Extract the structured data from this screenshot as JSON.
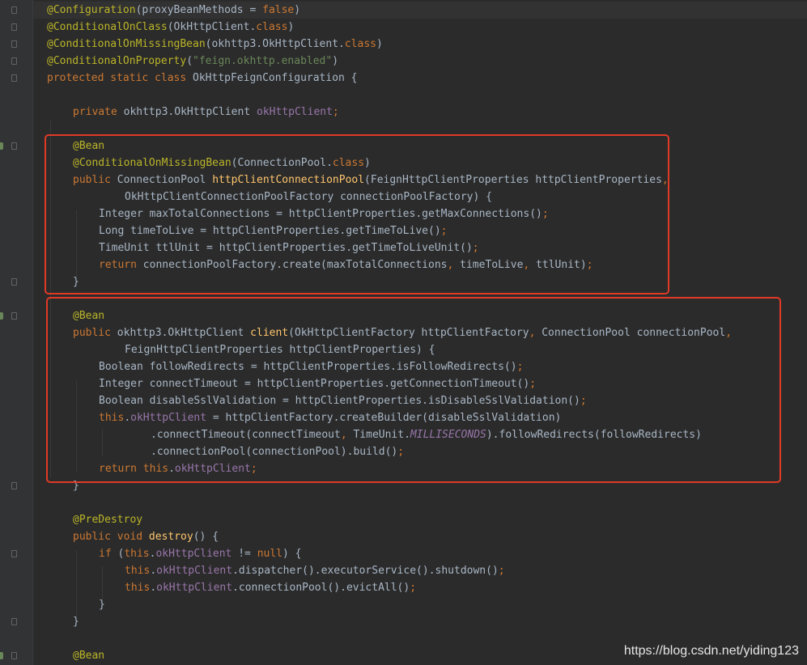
{
  "editor": {
    "lines": [
      {
        "indent": 0,
        "tokens": [
          [
            "annotation",
            "@Configuration"
          ],
          [
            "plain",
            "(proxyBeanMethods = "
          ],
          [
            "keyword",
            "false"
          ],
          [
            "plain",
            ")"
          ]
        ]
      },
      {
        "indent": 0,
        "tokens": [
          [
            "annotation",
            "@ConditionalOnClass"
          ],
          [
            "plain",
            "(OkHttpClient."
          ],
          [
            "keyword",
            "class"
          ],
          [
            "plain",
            ")"
          ]
        ]
      },
      {
        "indent": 0,
        "tokens": [
          [
            "annotation",
            "@ConditionalOnMissingBean"
          ],
          [
            "plain",
            "(okhttp3.OkHttpClient."
          ],
          [
            "keyword",
            "class"
          ],
          [
            "plain",
            ")"
          ]
        ]
      },
      {
        "indent": 0,
        "tokens": [
          [
            "annotation",
            "@ConditionalOnProperty"
          ],
          [
            "plain",
            "("
          ],
          [
            "string",
            "\"feign.okhttp.enabled\""
          ],
          [
            "plain",
            ")"
          ]
        ]
      },
      {
        "indent": 0,
        "tokens": [
          [
            "keyword",
            "protected static class "
          ],
          [
            "plain",
            "OkHttpFeignConfiguration {"
          ]
        ]
      },
      {
        "indent": 0,
        "tokens": []
      },
      {
        "indent": 1,
        "tokens": [
          [
            "keyword",
            "private "
          ],
          [
            "plain",
            "okhttp3.OkHttpClient "
          ],
          [
            "field",
            "okHttpClient"
          ],
          [
            "keyword",
            ";"
          ]
        ]
      },
      {
        "indent": 0,
        "tokens": []
      },
      {
        "indent": 1,
        "tokens": [
          [
            "annotation",
            "@Bean"
          ]
        ]
      },
      {
        "indent": 1,
        "tokens": [
          [
            "annotation",
            "@ConditionalOnMissingBean"
          ],
          [
            "plain",
            "(ConnectionPool."
          ],
          [
            "keyword",
            "class"
          ],
          [
            "plain",
            ")"
          ]
        ]
      },
      {
        "indent": 1,
        "tokens": [
          [
            "keyword",
            "public "
          ],
          [
            "plain",
            "ConnectionPool "
          ],
          [
            "method",
            "httpClientConnectionPool"
          ],
          [
            "plain",
            "(FeignHttpClientProperties httpClientProperties"
          ],
          [
            "keyword",
            ","
          ]
        ]
      },
      {
        "indent": 3,
        "tokens": [
          [
            "plain",
            "OkHttpClientConnectionPoolFactory connectionPoolFactory) {"
          ]
        ]
      },
      {
        "indent": 2,
        "tokens": [
          [
            "plain",
            "Integer maxTotalConnections = httpClientProperties.getMaxConnections()"
          ],
          [
            "keyword",
            ";"
          ]
        ]
      },
      {
        "indent": 2,
        "tokens": [
          [
            "plain",
            "Long timeToLive = httpClientProperties.getTimeToLive()"
          ],
          [
            "keyword",
            ";"
          ]
        ]
      },
      {
        "indent": 2,
        "tokens": [
          [
            "plain",
            "TimeUnit ttlUnit = httpClientProperties.getTimeToLiveUnit()"
          ],
          [
            "keyword",
            ";"
          ]
        ]
      },
      {
        "indent": 2,
        "tokens": [
          [
            "keyword",
            "return "
          ],
          [
            "plain",
            "connectionPoolFactory.create(maxTotalConnections"
          ],
          [
            "keyword",
            ", "
          ],
          [
            "plain",
            "timeToLive"
          ],
          [
            "keyword",
            ", "
          ],
          [
            "plain",
            "ttlUnit)"
          ],
          [
            "keyword",
            ";"
          ]
        ]
      },
      {
        "indent": 1,
        "tokens": [
          [
            "plain",
            "}"
          ]
        ]
      },
      {
        "indent": 0,
        "tokens": []
      },
      {
        "indent": 1,
        "tokens": [
          [
            "annotation",
            "@Bean"
          ]
        ]
      },
      {
        "indent": 1,
        "tokens": [
          [
            "keyword",
            "public "
          ],
          [
            "plain",
            "okhttp3.OkHttpClient "
          ],
          [
            "method",
            "client"
          ],
          [
            "plain",
            "(OkHttpClientFactory httpClientFactory"
          ],
          [
            "keyword",
            ", "
          ],
          [
            "plain",
            "ConnectionPool connectionPool"
          ],
          [
            "keyword",
            ","
          ]
        ]
      },
      {
        "indent": 3,
        "tokens": [
          [
            "plain",
            "FeignHttpClientProperties httpClientProperties) {"
          ]
        ]
      },
      {
        "indent": 2,
        "tokens": [
          [
            "plain",
            "Boolean followRedirects = httpClientProperties.isFollowRedirects()"
          ],
          [
            "keyword",
            ";"
          ]
        ]
      },
      {
        "indent": 2,
        "tokens": [
          [
            "plain",
            "Integer connectTimeout = httpClientProperties.getConnectionTimeout()"
          ],
          [
            "keyword",
            ";"
          ]
        ]
      },
      {
        "indent": 2,
        "tokens": [
          [
            "plain",
            "Boolean disableSslValidation = httpClientProperties.isDisableSslValidation()"
          ],
          [
            "keyword",
            ";"
          ]
        ]
      },
      {
        "indent": 2,
        "tokens": [
          [
            "keyword",
            "this"
          ],
          [
            "plain",
            "."
          ],
          [
            "field",
            "okHttpClient"
          ],
          [
            "plain",
            " = httpClientFactory.createBuilder(disableSslValidation)"
          ]
        ]
      },
      {
        "indent": 4,
        "tokens": [
          [
            "plain",
            ".connectTimeout(connectTimeout"
          ],
          [
            "keyword",
            ", "
          ],
          [
            "plain",
            "TimeUnit."
          ],
          [
            "const",
            "MILLISECONDS"
          ],
          [
            "plain",
            ").followRedirects(followRedirects)"
          ]
        ]
      },
      {
        "indent": 4,
        "tokens": [
          [
            "plain",
            ".connectionPool(connectionPool).build()"
          ],
          [
            "keyword",
            ";"
          ]
        ]
      },
      {
        "indent": 2,
        "tokens": [
          [
            "keyword",
            "return this"
          ],
          [
            "plain",
            "."
          ],
          [
            "field",
            "okHttpClient"
          ],
          [
            "keyword",
            ";"
          ]
        ]
      },
      {
        "indent": 1,
        "tokens": [
          [
            "plain",
            "}"
          ]
        ]
      },
      {
        "indent": 0,
        "tokens": []
      },
      {
        "indent": 1,
        "tokens": [
          [
            "annotation",
            "@PreDestroy"
          ]
        ]
      },
      {
        "indent": 1,
        "tokens": [
          [
            "keyword",
            "public void "
          ],
          [
            "method",
            "destroy"
          ],
          [
            "plain",
            "() {"
          ]
        ]
      },
      {
        "indent": 2,
        "tokens": [
          [
            "keyword",
            "if "
          ],
          [
            "plain",
            "("
          ],
          [
            "keyword",
            "this"
          ],
          [
            "plain",
            "."
          ],
          [
            "field",
            "okHttpClient"
          ],
          [
            "plain",
            " != "
          ],
          [
            "keyword",
            "null"
          ],
          [
            "plain",
            ") {"
          ]
        ]
      },
      {
        "indent": 3,
        "tokens": [
          [
            "keyword",
            "this"
          ],
          [
            "plain",
            "."
          ],
          [
            "field",
            "okHttpClient"
          ],
          [
            "plain",
            ".dispatcher().executorService().shutdown()"
          ],
          [
            "keyword",
            ";"
          ]
        ]
      },
      {
        "indent": 3,
        "tokens": [
          [
            "keyword",
            "this"
          ],
          [
            "plain",
            "."
          ],
          [
            "field",
            "okHttpClient"
          ],
          [
            "plain",
            ".connectionPool().evictAll()"
          ],
          [
            "keyword",
            ";"
          ]
        ]
      },
      {
        "indent": 2,
        "tokens": [
          [
            "plain",
            "}"
          ]
        ]
      },
      {
        "indent": 1,
        "tokens": [
          [
            "plain",
            "}"
          ]
        ]
      },
      {
        "indent": 0,
        "tokens": []
      },
      {
        "indent": 1,
        "tokens": [
          [
            "annotation",
            "@Bean"
          ]
        ]
      }
    ],
    "fold_markers": [
      0,
      1,
      2,
      3,
      4,
      8,
      16,
      18,
      28,
      32,
      36,
      38
    ],
    "bean_gutter_icons": [
      8,
      18,
      38
    ],
    "highlighted_blocks": [
      [
        8,
        16
      ],
      [
        18,
        28
      ]
    ]
  },
  "watermark": "https://blog.csdn.net/yiding123",
  "colors": {
    "background": "#2b2b2b",
    "annotation": "#bbb529",
    "keyword": "#cc7832",
    "string": "#6a8759",
    "field": "#9876aa",
    "method": "#ffc66d",
    "text": "#a9b7c6",
    "highlight_box": "#e03a27"
  }
}
